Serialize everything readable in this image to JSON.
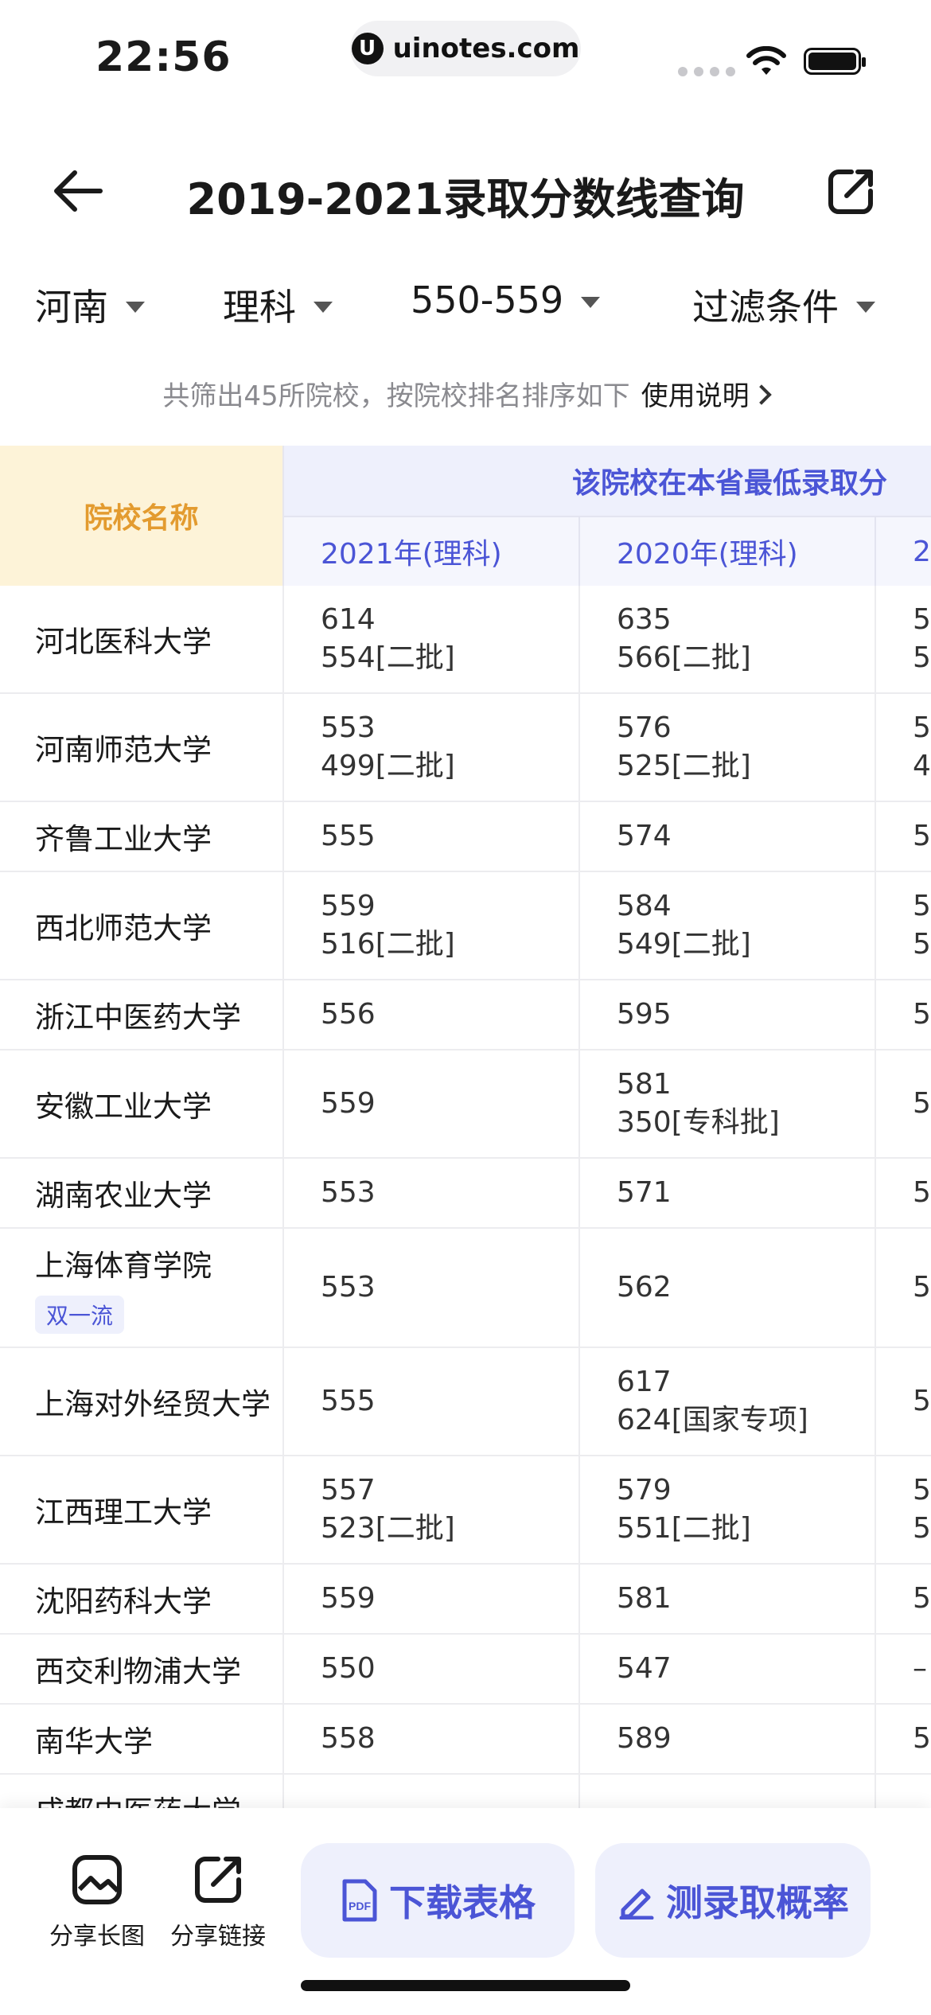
{
  "status": {
    "time": "22:56",
    "url": "uinotes.com"
  },
  "header": {
    "title": "2019-2021录取分数线查询"
  },
  "filters": [
    {
      "label": "河南"
    },
    {
      "label": "理科"
    },
    {
      "label": "550-559"
    },
    {
      "label": "过滤条件"
    }
  ],
  "summary": {
    "text": "共筛出45所院校，按院校排名排序如下",
    "help": "使用说明"
  },
  "table": {
    "name_header": "院校名称",
    "group_header": "该院校在本省最低录取分",
    "years": [
      "2021年(理科)",
      "2020年(理科)",
      "2"
    ],
    "rows": [
      {
        "name": "河北医科大学",
        "badge": "",
        "y2021": [
          "614",
          "554[二批]"
        ],
        "y2020": [
          "635",
          "566[二批]"
        ],
        "y2019": [
          "5",
          "5"
        ]
      },
      {
        "name": "河南师范大学",
        "badge": "",
        "y2021": [
          "553",
          "499[二批]"
        ],
        "y2020": [
          "576",
          "525[二批]"
        ],
        "y2019": [
          "5",
          "4"
        ]
      },
      {
        "name": "齐鲁工业大学",
        "badge": "",
        "y2021": [
          "555"
        ],
        "y2020": [
          "574"
        ],
        "y2019": [
          "5"
        ]
      },
      {
        "name": "西北师范大学",
        "badge": "",
        "y2021": [
          "559",
          "516[二批]"
        ],
        "y2020": [
          "584",
          "549[二批]"
        ],
        "y2019": [
          "5",
          "5"
        ]
      },
      {
        "name": "浙江中医药大学",
        "badge": "",
        "y2021": [
          "556"
        ],
        "y2020": [
          "595"
        ],
        "y2019": [
          "5"
        ]
      },
      {
        "name": "安徽工业大学",
        "badge": "",
        "y2021": [
          "559"
        ],
        "y2020": [
          "581",
          "350[专科批]"
        ],
        "y2019": [
          "5"
        ]
      },
      {
        "name": "湖南农业大学",
        "badge": "",
        "y2021": [
          "553"
        ],
        "y2020": [
          "571"
        ],
        "y2019": [
          "5"
        ]
      },
      {
        "name": "上海体育学院",
        "badge": "双一流",
        "y2021": [
          "553"
        ],
        "y2020": [
          "562"
        ],
        "y2019": [
          "5"
        ]
      },
      {
        "name": "上海对外经贸大学",
        "badge": "",
        "y2021": [
          "555"
        ],
        "y2020": [
          "617",
          "624[国家专项]"
        ],
        "y2019": [
          "5"
        ]
      },
      {
        "name": "江西理工大学",
        "badge": "",
        "y2021": [
          "557",
          "523[二批]"
        ],
        "y2020": [
          "579",
          "551[二批]"
        ],
        "y2019": [
          "5",
          "5"
        ]
      },
      {
        "name": "沈阳药科大学",
        "badge": "",
        "y2021": [
          "559"
        ],
        "y2020": [
          "581"
        ],
        "y2019": [
          "5"
        ]
      },
      {
        "name": "西交利物浦大学",
        "badge": "",
        "y2021": [
          "550"
        ],
        "y2020": [
          "547"
        ],
        "y2019": [
          "–"
        ]
      },
      {
        "name": "南华大学",
        "badge": "",
        "y2021": [
          "558"
        ],
        "y2020": [
          "589"
        ],
        "y2019": [
          "5"
        ]
      },
      {
        "name": "成都中医药大学",
        "badge": "",
        "y2021": [
          ""
        ],
        "y2020": [
          ""
        ],
        "y2019": [
          ""
        ]
      }
    ]
  },
  "bottom": {
    "share_image": "分享长图",
    "share_link": "分享链接",
    "download": "下载表格",
    "probability": "测录取概率"
  },
  "icons": {
    "back": "arrow-left-icon",
    "share": "share-external-icon",
    "pdf": "pdf-icon",
    "pen": "pen-icon",
    "image": "image-icon"
  },
  "colors": {
    "accent": "#4b55d6",
    "header_orange": "#e39b2f",
    "header_bg": "#fdf3d8",
    "soft_blue": "#eef0fc"
  }
}
